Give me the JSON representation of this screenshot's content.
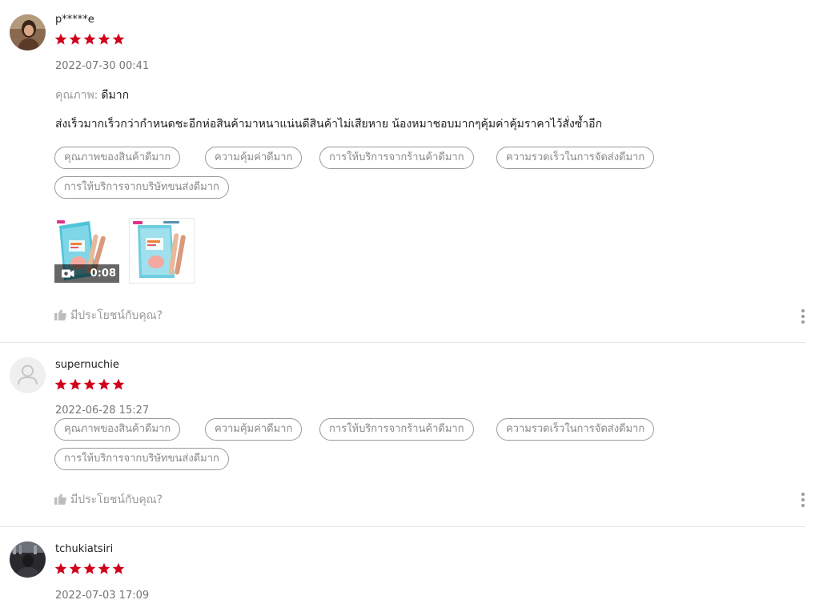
{
  "colors": {
    "star": "#d0011b",
    "muted_text": "#757575",
    "tag_border": "#9a9a9a",
    "divider": "#e5e5e5"
  },
  "reviews": [
    {
      "username": "p*****e",
      "rating": 5,
      "datetime": "2022-07-30 00:41",
      "quality_label": "คุณภาพ:",
      "quality_value": "ดีมาก",
      "comment": "ส่งเร็วมากเร็วกว่ากำหนดชะอีกห่อสินค้ามาหนาแน่นดีสินค้าไม่เสียหาย น้องหมาชอบมากๆคุ้มค่าคุ้มราคาไว้สั่งซ้ำอีก",
      "tags": [
        "คุณภาพของสินค้าดีมาก",
        "ความคุ้มค่าดีมาก",
        "การให้บริการจากร้านค้าดีมาก",
        "ความรวดเร็วในการจัดส่งดีมาก",
        "การให้บริการจากบริษัทขนส่งดีมาก"
      ],
      "media": [
        {
          "type": "video",
          "duration": "0:08",
          "icon": "video-camera-icon"
        },
        {
          "type": "image"
        }
      ],
      "helpful_label": "มีประโยชน์กับคุณ?"
    },
    {
      "username": "supernuchie",
      "rating": 5,
      "datetime": "2022-06-28 15:27",
      "tags": [
        "คุณภาพของสินค้าดีมาก",
        "ความคุ้มค่าดีมาก",
        "การให้บริการจากร้านค้าดีมาก",
        "ความรวดเร็วในการจัดส่งดีมาก",
        "การให้บริการจากบริษัทขนส่งดีมาก"
      ],
      "helpful_label": "มีประโยชน์กับคุณ?"
    },
    {
      "username": "tchukiatsiri",
      "rating": 5,
      "datetime": "2022-07-03 17:09"
    }
  ]
}
